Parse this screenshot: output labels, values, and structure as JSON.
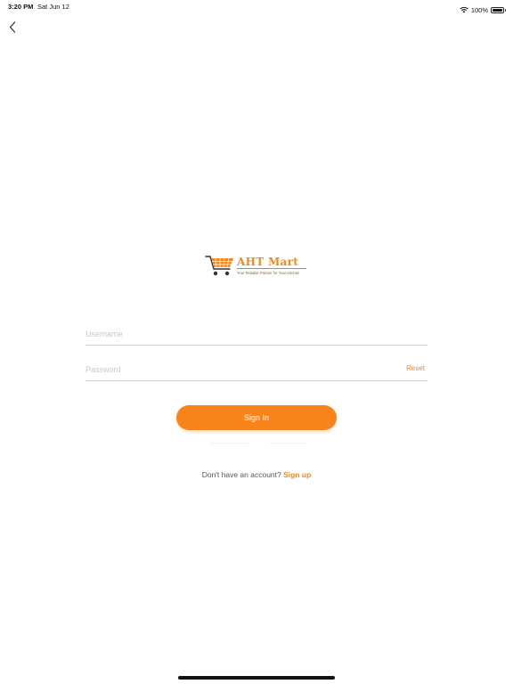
{
  "status_bar": {
    "time": "3:20 PM",
    "date": "Sat Jun 12",
    "battery": "100%",
    "battery_level": 1.0,
    "wifi_icon": "wifi-icon",
    "battery_icon": "battery-icon"
  },
  "nav": {
    "back_icon": "chevron-left-icon"
  },
  "logo": {
    "title": "AHT Mart",
    "tagline": "Your Reliable Partner for Your Kitchen",
    "icon": "shopping-cart-icon"
  },
  "form": {
    "username_placeholder": "Username",
    "username_value": "",
    "password_placeholder": "Password",
    "password_value": "",
    "reset_label": "Reset",
    "sign_in_label": "Sign In"
  },
  "signup": {
    "prompt": "Don't have an account?",
    "link_label": "Sign up"
  },
  "colors": {
    "accent": "#f7851c",
    "divider": "#cfcfcf"
  }
}
